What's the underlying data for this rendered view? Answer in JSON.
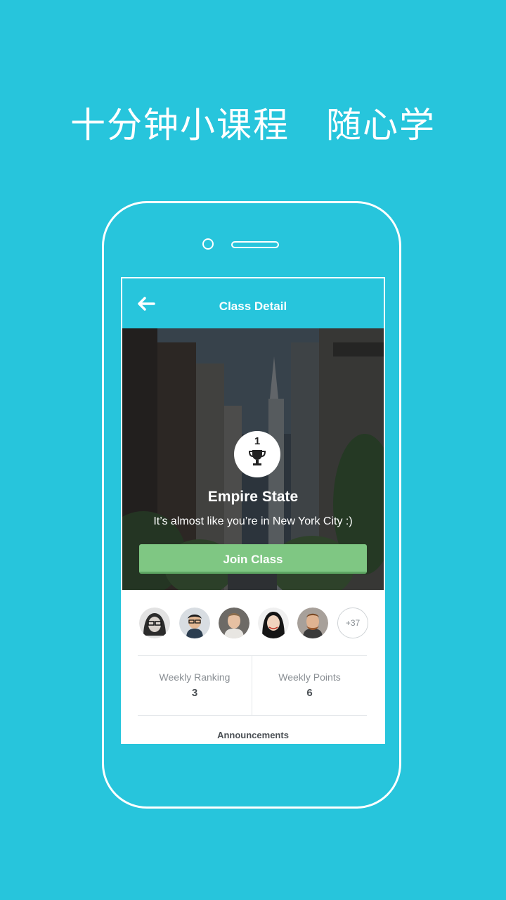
{
  "headline": {
    "part1": "十分钟小课程",
    "part2": "随心学"
  },
  "navbar": {
    "title": "Class Detail",
    "back_icon": "arrow-left-icon"
  },
  "hero": {
    "rank": "1",
    "trophy_icon": "trophy-icon",
    "class_name": "Empire State",
    "description": "It’s almost like you’re in New York City :)",
    "join_label": "Join Class"
  },
  "members": {
    "more_count": "+37"
  },
  "stats": {
    "weekly_ranking_label": "Weekly Ranking",
    "weekly_ranking_value": "3",
    "weekly_points_label": "Weekly Points",
    "weekly_points_value": "6"
  },
  "announcements": {
    "title": "Announcements"
  },
  "colors": {
    "brand": "#27c5dc",
    "join": "#7fc783"
  }
}
